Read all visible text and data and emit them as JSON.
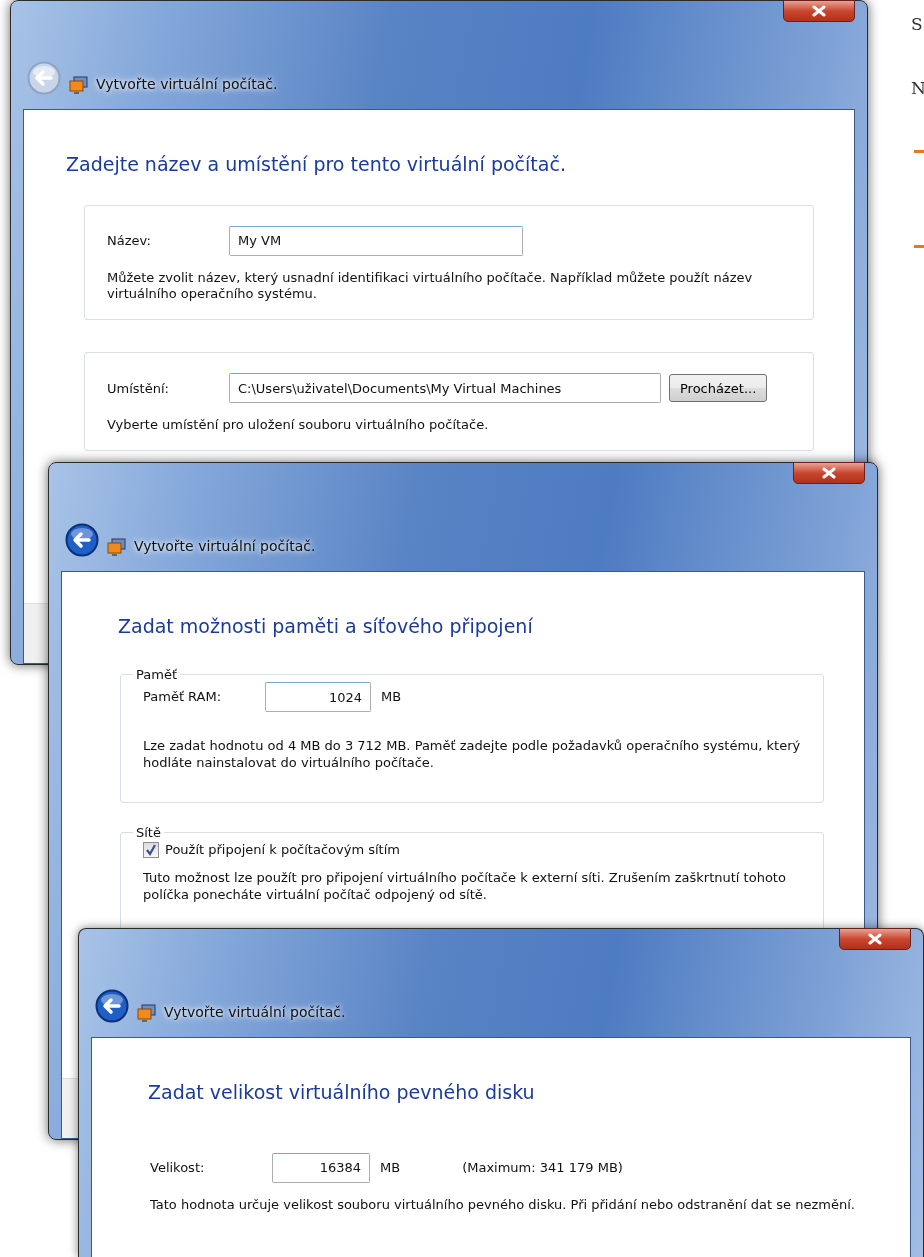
{
  "slide": {
    "title_lines": [
      "S",
      "N"
    ]
  },
  "windows": [
    {
      "title": "Vytvořte virtuální počítač.",
      "back_enabled": false,
      "heading": "Zadejte název a umístění pro tento virtuální počítač.",
      "groups": [
        {
          "framed": true,
          "rows": [
            {
              "kind": "text_field",
              "label": "Název:",
              "value": "My VM"
            }
          ],
          "note": "Můžete zvolit název, který usnadní identifikaci virtuálního počítače. Například můžete použít název virtuálního operačního systému."
        },
        {
          "framed": true,
          "rows": [
            {
              "kind": "text_field",
              "label": "Umístění:",
              "value": "C:\\Users\\uživatel\\Documents\\My Virtual Machines",
              "button": "Procházet..."
            }
          ],
          "note": "Vyberte umístění pro uložení souboru virtuálního počítače."
        }
      ]
    },
    {
      "title": "Vytvořte virtuální počítač.",
      "back_enabled": true,
      "heading": "Zadat možnosti paměti a síťového připojení",
      "groups": [
        {
          "framed": true,
          "legend": "Paměť",
          "rows": [
            {
              "kind": "number_field",
              "label": "Paměť RAM:",
              "value": "1024",
              "unit": "MB"
            }
          ],
          "note": "Lze zadat hodnotu od 4 MB do 3 712 MB. Paměť zadejte podle požadavků operačního systému, který hodláte nainstalovat do virtuálního počítače."
        },
        {
          "framed": true,
          "legend": "Sítě",
          "rows": [
            {
              "kind": "checkbox",
              "label": "Použít připojení k počítačovým sítím",
              "checked": true
            }
          ],
          "note": "Tuto možnost lze použít pro připojení virtuálního počítače k externí síti. Zrušením zaškrtnutí tohoto políčka ponecháte virtuální počítač odpojený od sítě."
        }
      ]
    },
    {
      "title": "Vytvořte virtuální počítač.",
      "back_enabled": true,
      "heading": "Zadat velikost virtuálního pevného disku",
      "groups": [
        {
          "framed": false,
          "rows": [
            {
              "kind": "number_field",
              "label": "Velikost:",
              "value": "16384",
              "unit": "MB",
              "hint": "(Maximum: 341 179 MB)"
            }
          ],
          "note": "Tato hodnota určuje velikost souboru virtuálního pevného disku. Při přidání nebo odstranění dat se nezmění."
        }
      ]
    }
  ]
}
